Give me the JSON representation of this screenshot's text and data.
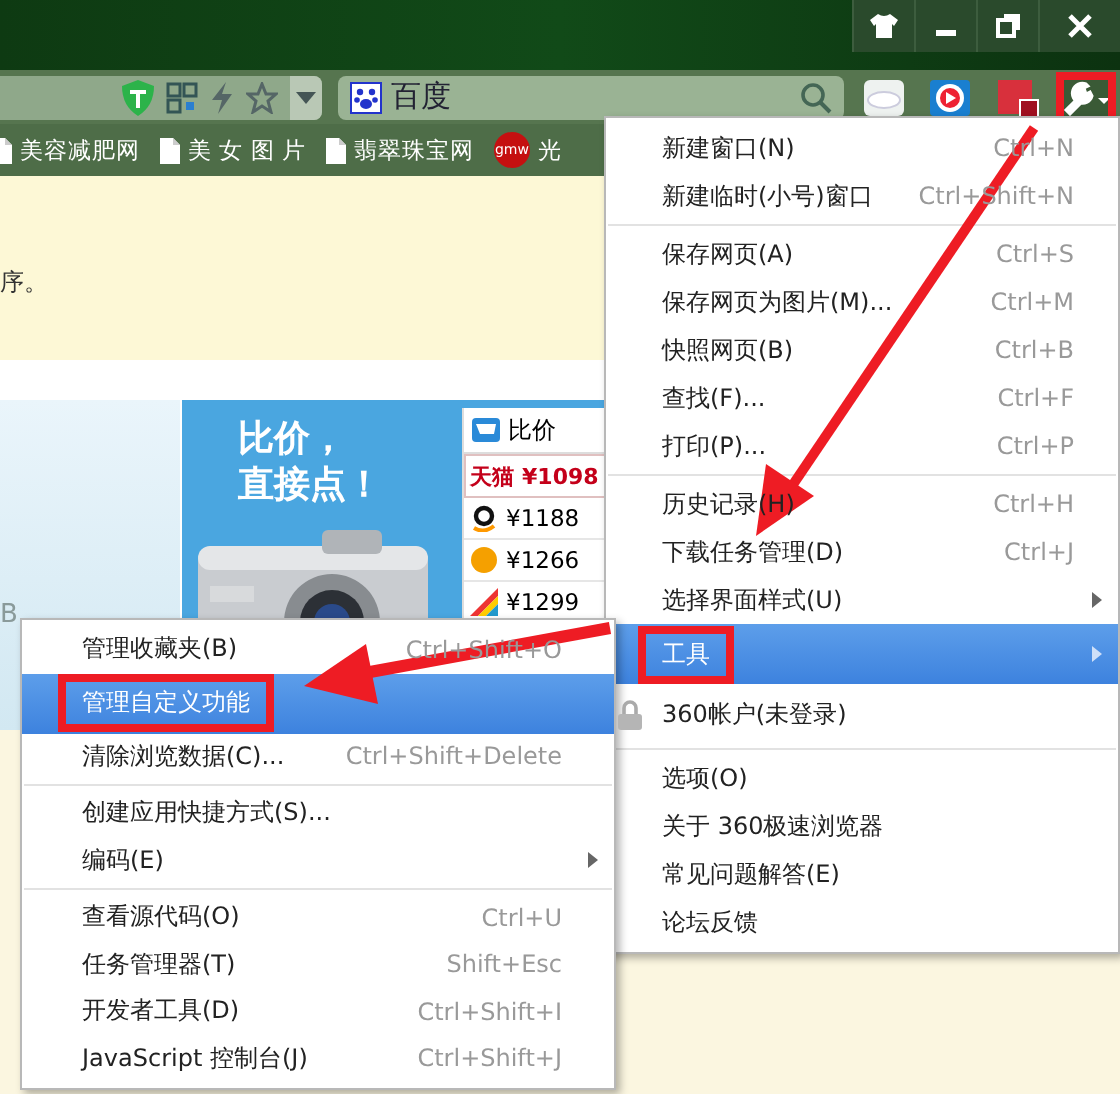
{
  "toolbar": {
    "search": {
      "value": "百度"
    },
    "wrench_outlined": true
  },
  "bookmarks": [
    {
      "label": "美容减肥网",
      "kind": "page"
    },
    {
      "label": "美 女 图 片",
      "kind": "page"
    },
    {
      "label": "翡翠珠宝网",
      "kind": "page"
    },
    {
      "label": "光",
      "kind": "logo",
      "logo_text": "gmw"
    }
  ],
  "page": {
    "notice": "序。",
    "side_text": "B",
    "ad": {
      "headline": [
        "比价，",
        "直接点！"
      ],
      "panel_title": "比价",
      "prices": [
        {
          "shop": "天猫",
          "price": "¥1098",
          "kind": "featured"
        },
        {
          "price": "¥1188",
          "kind": "amazon"
        },
        {
          "price": "¥1266",
          "kind": "orange"
        },
        {
          "price": "¥1299",
          "kind": "stripes"
        }
      ]
    }
  },
  "main_menu": {
    "groups": [
      [
        {
          "label": "新建窗口(N)",
          "shortcut": "Ctrl+N",
          "kind": "command",
          "selected": false,
          "has_submenu": false,
          "outlined": false
        },
        {
          "label": "新建临时(小号)窗口",
          "shortcut": "Ctrl+Shift+N",
          "kind": "command",
          "selected": false,
          "has_submenu": false,
          "outlined": false
        }
      ],
      [
        {
          "label": "保存网页(A)",
          "shortcut": "Ctrl+S",
          "kind": "command",
          "selected": false,
          "has_submenu": false,
          "outlined": false
        },
        {
          "label": "保存网页为图片(M)...",
          "shortcut": "Ctrl+M",
          "kind": "command",
          "selected": false,
          "has_submenu": false,
          "outlined": false
        },
        {
          "label": "快照网页(B)",
          "shortcut": "Ctrl+B",
          "kind": "command",
          "selected": false,
          "has_submenu": false,
          "outlined": false
        },
        {
          "label": "查找(F)...",
          "shortcut": "Ctrl+F",
          "kind": "command",
          "selected": false,
          "has_submenu": false,
          "outlined": false
        },
        {
          "label": "打印(P)...",
          "shortcut": "Ctrl+P",
          "kind": "command",
          "selected": false,
          "has_submenu": false,
          "outlined": false
        }
      ],
      [
        {
          "label": "历史记录(H)",
          "shortcut": "Ctrl+H",
          "kind": "command",
          "selected": false,
          "has_submenu": false,
          "outlined": false
        },
        {
          "label": "下载任务管理(D)",
          "shortcut": "Ctrl+J",
          "kind": "command",
          "selected": false,
          "has_submenu": false,
          "outlined": false
        },
        {
          "label": "选择界面样式(U)",
          "kind": "command",
          "selected": false,
          "has_submenu": true,
          "outlined": false
        },
        {
          "label": "工具",
          "kind": "command",
          "selected": true,
          "has_submenu": true,
          "outlined": true
        },
        {
          "label": "360帐户(未登录)",
          "kind": "account",
          "selected": false,
          "has_submenu": false,
          "outlined": false
        }
      ],
      [
        {
          "label": "选项(O)",
          "kind": "command",
          "selected": false,
          "has_submenu": false,
          "outlined": false
        },
        {
          "label": "关于 360极速浏览器",
          "kind": "command",
          "selected": false,
          "has_submenu": false,
          "outlined": false
        },
        {
          "label": "常见问题解答(E)",
          "kind": "command",
          "selected": false,
          "has_submenu": false,
          "outlined": false
        },
        {
          "label": "论坛反馈",
          "kind": "command",
          "selected": false,
          "has_submenu": false,
          "outlined": false
        }
      ]
    ]
  },
  "tools_submenu": {
    "groups": [
      [
        {
          "label": "管理收藏夹(B)",
          "shortcut": "Ctrl+Shift+O",
          "kind": "command",
          "selected": false,
          "has_submenu": false,
          "outlined": false
        },
        {
          "label": "管理自定义功能",
          "kind": "command",
          "selected": true,
          "has_submenu": false,
          "outlined": true
        },
        {
          "label": "清除浏览数据(C)...",
          "shortcut": "Ctrl+Shift+Delete",
          "kind": "command",
          "selected": false,
          "has_submenu": false,
          "outlined": false
        }
      ],
      [
        {
          "label": "创建应用快捷方式(S)...",
          "kind": "command",
          "selected": false,
          "has_submenu": false,
          "outlined": false
        },
        {
          "label": "编码(E)",
          "kind": "command",
          "selected": false,
          "has_submenu": true,
          "outlined": false
        }
      ],
      [
        {
          "label": "查看源代码(O)",
          "shortcut": "Ctrl+U",
          "kind": "command",
          "selected": false,
          "has_submenu": false,
          "outlined": false
        },
        {
          "label": "任务管理器(T)",
          "shortcut": "Shift+Esc",
          "kind": "command",
          "selected": false,
          "has_submenu": false,
          "outlined": false
        },
        {
          "label": "开发者工具(D)",
          "shortcut": "Ctrl+Shift+I",
          "kind": "command",
          "selected": false,
          "has_submenu": false,
          "outlined": false
        },
        {
          "label": "JavaScript 控制台(J)",
          "shortcut": "Ctrl+Shift+J",
          "kind": "command",
          "selected": false,
          "has_submenu": false,
          "outlined": false
        }
      ]
    ]
  }
}
